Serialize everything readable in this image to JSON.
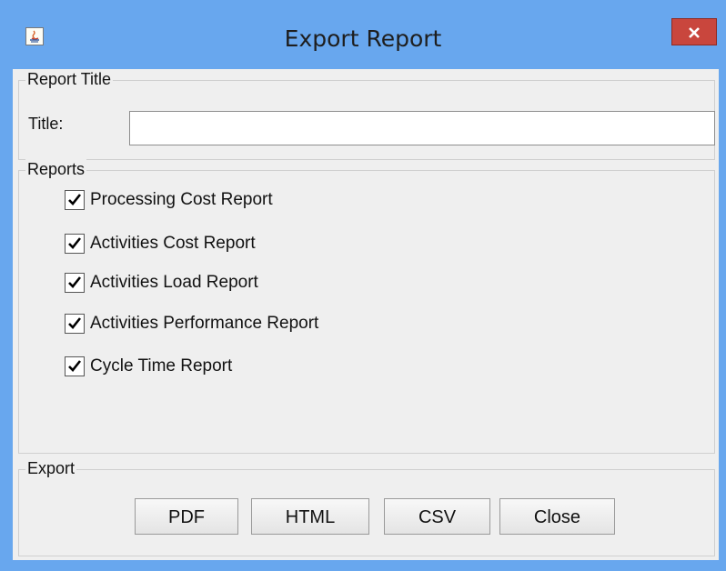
{
  "window": {
    "title": "Export Report",
    "close_label": "close"
  },
  "report_title_group": {
    "legend": "Report Title",
    "field_label": "Title:",
    "field_value": ""
  },
  "reports_group": {
    "legend": "Reports",
    "items": [
      {
        "label": "Processing Cost Report",
        "checked": true
      },
      {
        "label": "Activities Cost Report",
        "checked": true
      },
      {
        "label": "Activities Load Report",
        "checked": true
      },
      {
        "label": "Activities Performance Report",
        "checked": true
      },
      {
        "label": "Cycle Time Report",
        "checked": true
      }
    ]
  },
  "export_group": {
    "legend": "Export",
    "buttons": {
      "pdf": "PDF",
      "html": "HTML",
      "csv": "CSV",
      "close": "Close"
    }
  },
  "colors": {
    "frame": "#68a7ee",
    "panel": "#efefef",
    "close_button": "#c9463d"
  }
}
